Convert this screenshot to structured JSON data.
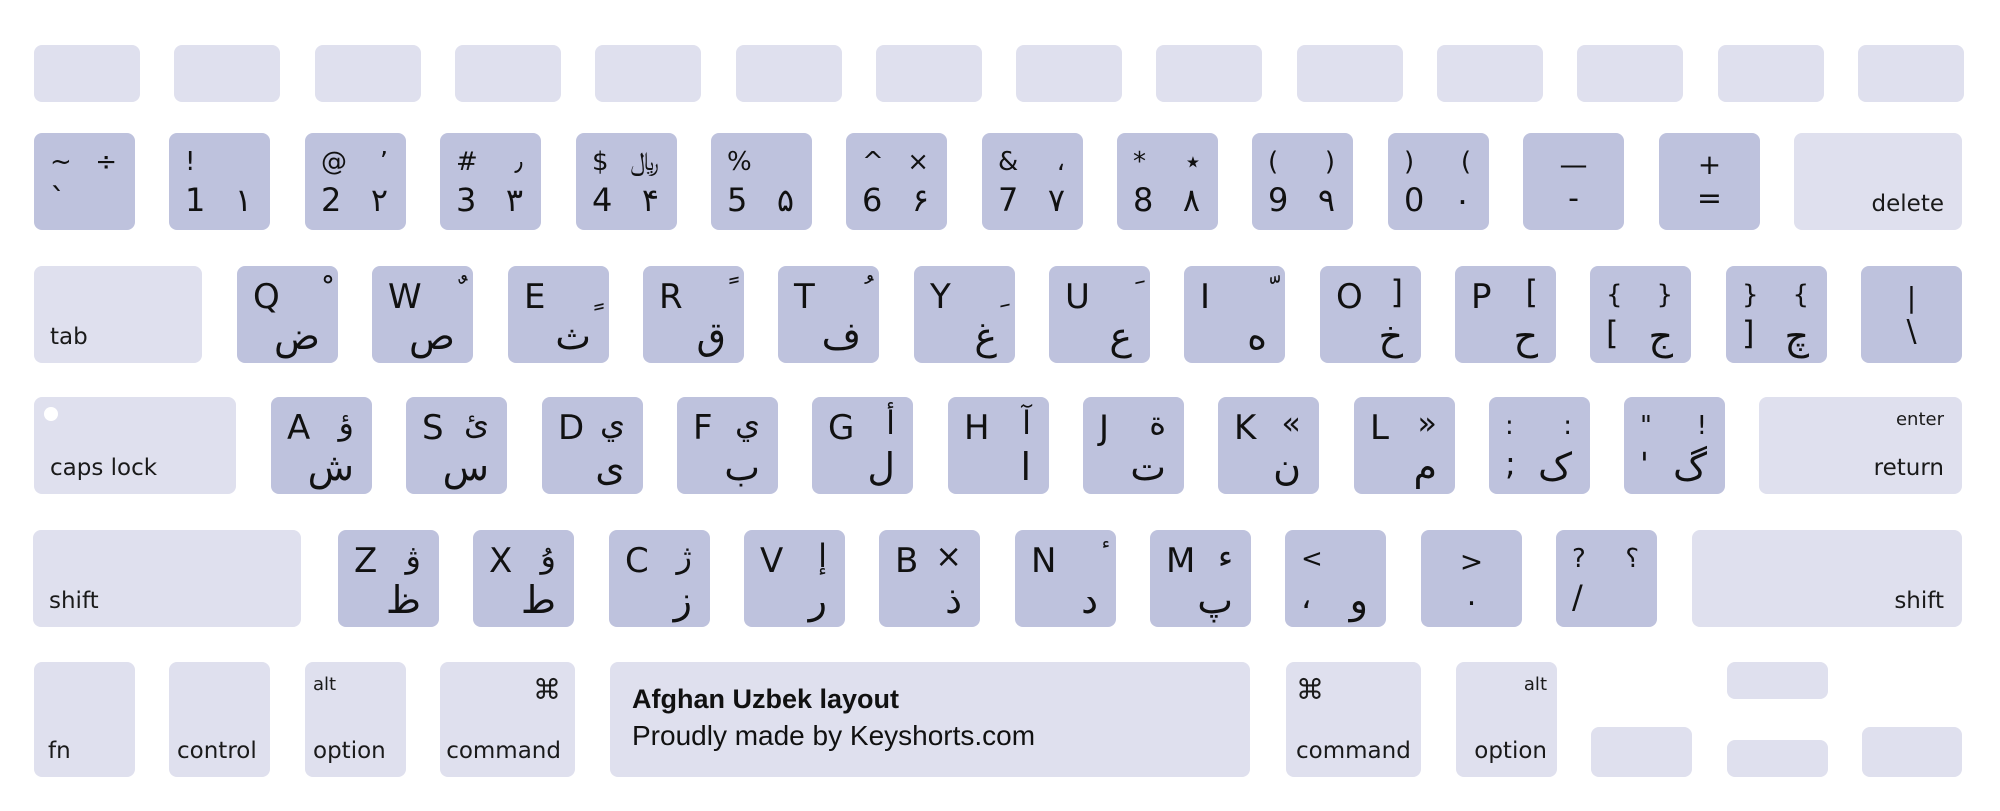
{
  "layout_title": "Afghan Uzbek layout",
  "credit": "Proudly made by Keyshorts.com",
  "colors": {
    "light_key": "#dfe0ee",
    "dark_key": "#bec2dd",
    "background": "#ffffff"
  },
  "function_row": {
    "count": 14
  },
  "number_row": [
    {
      "shift": "~",
      "alt_shift": "÷",
      "base": "`",
      "alt_base": ""
    },
    {
      "shift": "!",
      "alt_shift": "",
      "base": "1",
      "alt_base": "۱"
    },
    {
      "shift": "@",
      "alt_shift": "٬",
      "base": "2",
      "alt_base": "۲"
    },
    {
      "shift": "#",
      "alt_shift": "٫",
      "base": "3",
      "alt_base": "۳"
    },
    {
      "shift": "$",
      "alt_shift": "﷼",
      "base": "4",
      "alt_base": "۴"
    },
    {
      "shift": "%",
      "alt_shift": "",
      "base": "5",
      "alt_base": "۵"
    },
    {
      "shift": "^",
      "alt_shift": "×",
      "base": "6",
      "alt_base": "۶"
    },
    {
      "shift": "&",
      "alt_shift": "،",
      "base": "7",
      "alt_base": "۷"
    },
    {
      "shift": "*",
      "alt_shift": "٭",
      "base": "8",
      "alt_base": "۸"
    },
    {
      "shift": "(",
      "alt_shift": ")",
      "base": "9",
      "alt_base": "۹"
    },
    {
      "shift": ")",
      "alt_shift": "(",
      "base": "0",
      "alt_base": "۰"
    },
    {
      "shift": "—",
      "base": "-"
    },
    {
      "shift": "+",
      "base": "="
    }
  ],
  "delete_label": "delete",
  "tab_label": "tab",
  "qwerty_row": [
    {
      "letter": "Q",
      "alt_shift": "ْ",
      "alt_base": "ض"
    },
    {
      "letter": "W",
      "alt_shift": "ٌ",
      "alt_base": "ص"
    },
    {
      "letter": "E",
      "alt_shift": "ٍ",
      "alt_base": "ث"
    },
    {
      "letter": "R",
      "alt_shift": "ً",
      "alt_base": "ق"
    },
    {
      "letter": "T",
      "alt_shift": "ُ",
      "alt_base": "ف"
    },
    {
      "letter": "Y",
      "alt_shift": "ِ",
      "alt_base": "غ"
    },
    {
      "letter": "U",
      "alt_shift": "َ",
      "alt_base": "ع"
    },
    {
      "letter": "I",
      "alt_shift": "ّ",
      "alt_base": "ه"
    },
    {
      "letter": "O",
      "alt_shift": "]",
      "alt_base": "خ"
    },
    {
      "letter": "P",
      "alt_shift": "[",
      "alt_base": "ح"
    },
    {
      "letter": "{",
      "alt_shift": "}",
      "base": "[",
      "alt_base": "ج"
    },
    {
      "letter": "}",
      "alt_shift": "{",
      "base": "]",
      "alt_base": "چ"
    },
    {
      "shift": "|",
      "base": "\\"
    }
  ],
  "caps_label": "caps lock",
  "home_row": [
    {
      "letter": "A",
      "alt_shift": "ؤ",
      "alt_base": "ش"
    },
    {
      "letter": "S",
      "alt_shift": "ئ",
      "alt_base": "س"
    },
    {
      "letter": "D",
      "alt_shift": "ي",
      "alt_base": "ی"
    },
    {
      "letter": "F",
      "alt_shift": "ي",
      "alt_base": "ب"
    },
    {
      "letter": "G",
      "alt_shift": "أ",
      "alt_base": "ل"
    },
    {
      "letter": "H",
      "alt_shift": "آ",
      "alt_base": "ا"
    },
    {
      "letter": "J",
      "alt_shift": "ة",
      "alt_base": "ت"
    },
    {
      "letter": "K",
      "alt_shift": "«",
      "alt_base": "ن"
    },
    {
      "letter": "L",
      "alt_shift": "»",
      "alt_base": "م"
    },
    {
      "letter": ":",
      "alt_shift": ":",
      "base": ";",
      "alt_base": "ک"
    },
    {
      "letter": "\"",
      "alt_shift": "!",
      "base": "'",
      "alt_base": "گ"
    }
  ],
  "enter_label": "enter",
  "return_label": "return",
  "shift_label": "shift",
  "bottom_letter_row": [
    {
      "letter": "Z",
      "alt_shift": "ۋ",
      "alt_base": "ظ"
    },
    {
      "letter": "X",
      "alt_shift": "ۇ",
      "alt_base": "ط"
    },
    {
      "letter": "C",
      "alt_shift": "ژ",
      "alt_base": "ز"
    },
    {
      "letter": "V",
      "alt_shift": "إ",
      "alt_base": "ر"
    },
    {
      "letter": "B",
      "alt_shift": "×",
      "alt_base": "ذ"
    },
    {
      "letter": "N",
      "alt_shift": "ٔ",
      "alt_base": "د"
    },
    {
      "letter": "M",
      "alt_shift": "ء",
      "alt_base": "پ"
    },
    {
      "letter": "<",
      "alt_shift": "",
      "base": "،",
      "alt_base": "و"
    },
    {
      "letter": ">",
      "base": "."
    },
    {
      "letter": "?",
      "alt_shift": "؟",
      "base": "/",
      "alt_base": ""
    }
  ],
  "bottom_row": {
    "fn": "fn",
    "control": "control",
    "option_left": {
      "top": "alt",
      "bottom": "option"
    },
    "command_left": {
      "top": "⌘",
      "bottom": "command"
    },
    "command_right": {
      "top": "⌘",
      "bottom": "command"
    },
    "option_right": {
      "top": "alt",
      "bottom": "option"
    }
  }
}
